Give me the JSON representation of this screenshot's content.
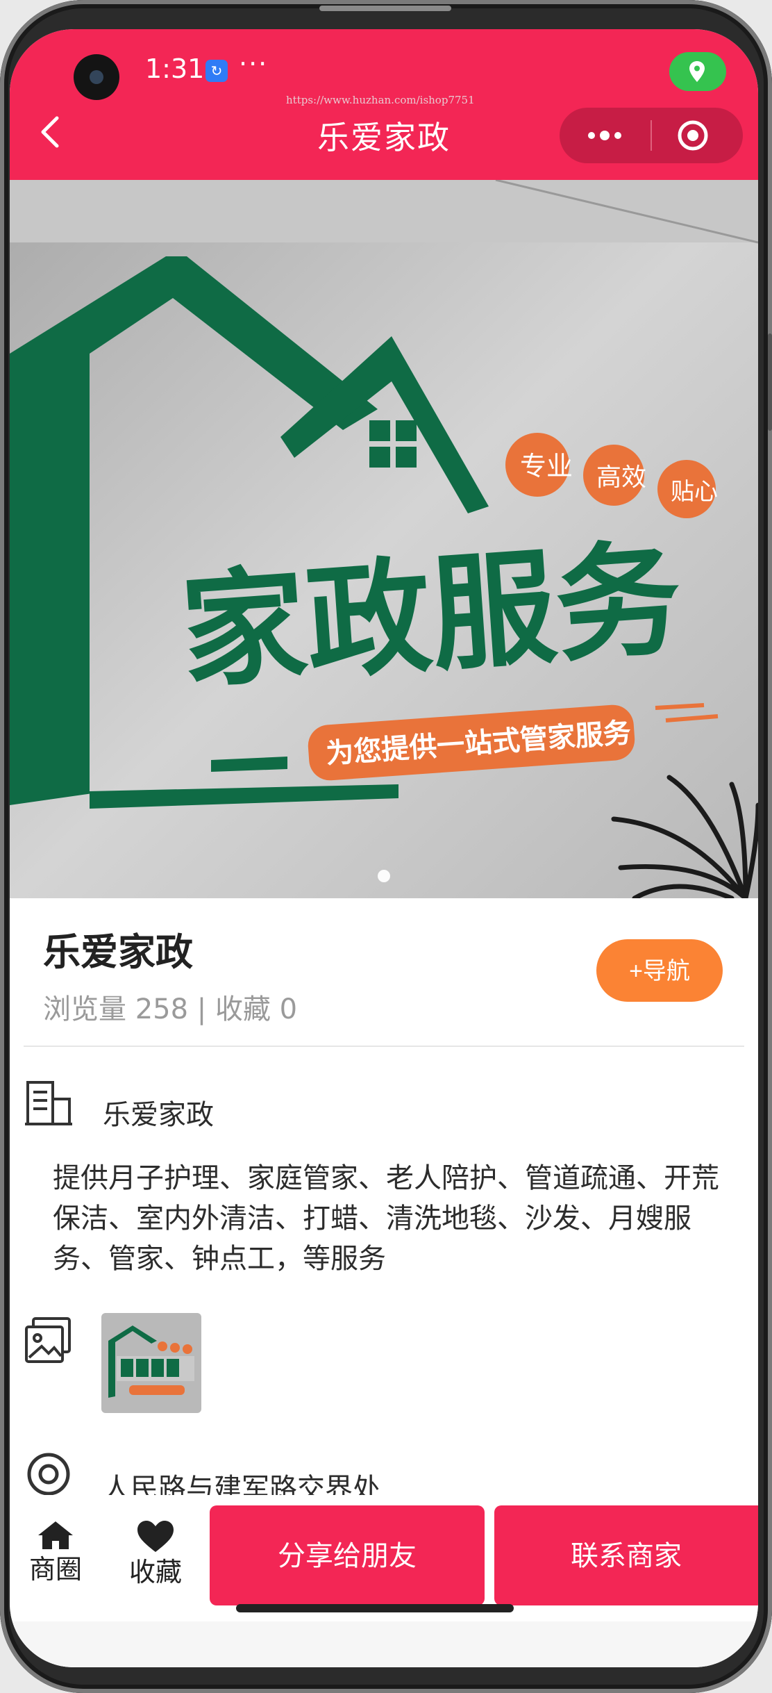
{
  "status": {
    "time": "1:31",
    "badge": "↻",
    "dots": "···"
  },
  "watermark": "https://www.huzhan.com/ishop7751",
  "header": {
    "title": "乐爱家政"
  },
  "banner": {
    "sign_main": "家政服务",
    "sign_tags": [
      "专业",
      "高效",
      "贴心"
    ],
    "sign_slogan": "为您提供一站式管家服务"
  },
  "shop": {
    "name": "乐爱家政",
    "stats": "浏览量 258 | 收藏 0",
    "nav_label": "+导航",
    "info_name": "乐爱家政",
    "description": "提供月子护理、家庭管家、老人陪护、管道疏通、开荒保洁、室内外清洁、打蜡、清洗地毯、沙发、月嫂服务、管家、钟点工，等服务",
    "address": "人民路与建军路交界处"
  },
  "bottom": {
    "tab_home": "商圈",
    "tab_fav": "收藏",
    "share": "分享给朋友",
    "contact": "联系商家"
  },
  "colors": {
    "brand": "#f32655",
    "nav": "#fb8334",
    "location": "#35c34f"
  }
}
